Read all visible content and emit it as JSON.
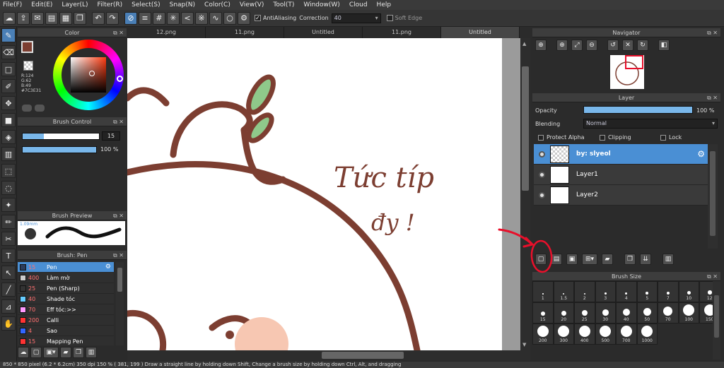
{
  "menu": [
    "File(F)",
    "Edit(E)",
    "Layer(L)",
    "Filter(R)",
    "Select(S)",
    "Snap(N)",
    "Color(C)",
    "View(V)",
    "Tool(T)",
    "Window(W)",
    "Cloud",
    "Help"
  ],
  "toolbar": {
    "antialiasing_label": "AntiAliasing",
    "correction_label": "Correction",
    "correction_value": "40",
    "soft_edge_label": "Soft Edge"
  },
  "tabs": [
    "12.png",
    "11.png",
    "Untitled",
    "11.png",
    "Untitled"
  ],
  "color_panel": {
    "title": "Color",
    "r": "R:124",
    "g": "G:62",
    "b": "B:49",
    "hex": "#7C3E31"
  },
  "brush_control": {
    "title": "Brush Control",
    "size": "15",
    "opacity": "100 %"
  },
  "brush_preview": {
    "title": "Brush Preview",
    "size_label": "1.09mm"
  },
  "brush_list": {
    "title": "Brush: Pen",
    "items": [
      {
        "size": "15",
        "name": "Pen",
        "color": "#2c3c5a"
      },
      {
        "size": "400",
        "name": "Làm mờ",
        "color": "#cccccc"
      },
      {
        "size": "25",
        "name": "Pen (Sharp)",
        "color": "#333333"
      },
      {
        "size": "40",
        "name": "Shade tóc",
        "color": "#66ccff"
      },
      {
        "size": "70",
        "name": "Eff tóc:>>",
        "color": "#ff99ff"
      },
      {
        "size": "200",
        "name": "Calli",
        "color": "#ff3333"
      },
      {
        "size": "4",
        "name": "Sao",
        "color": "#3366ff"
      },
      {
        "size": "15",
        "name": "Mapping Pen",
        "color": "#ff3333"
      }
    ]
  },
  "canvas": {
    "handwriting_line1": "Tức típ",
    "handwriting_line2": "đy !"
  },
  "navigator": {
    "title": "Navigator"
  },
  "layer_panel": {
    "title": "Layer",
    "opacity_label": "Opacity",
    "opacity_value": "100 %",
    "opacity_fraction": 1.0,
    "blending_label": "Blending",
    "blending_value": "Normal",
    "protect_alpha": "Protect Alpha",
    "clipping": "Clipping",
    "lock": "Lock",
    "layers": [
      {
        "name": "by: slyeol",
        "selected": true
      },
      {
        "name": "Layer1",
        "selected": false
      },
      {
        "name": "Layer2",
        "selected": false
      }
    ]
  },
  "brush_size": {
    "title": "Brush Size",
    "sizes": [
      "1",
      "1.5",
      "2",
      "3",
      "4",
      "5",
      "7",
      "10",
      "12",
      "15",
      "20",
      "25",
      "30",
      "40",
      "50",
      "70",
      "100",
      "150",
      "200",
      "300",
      "400",
      "500",
      "700",
      "1000"
    ]
  },
  "status": "850 * 850 pixel  (6.2 * 6.2cm)  350 dpi  150 %  ( 381, 199 )  Draw a straight line by holding down Shift, Change a brush size by holding down Ctrl, Alt, and dragging",
  "colors": {
    "accent": "#4a8fd4",
    "brush_color": "#7C3E31",
    "annotation": "#e8102b"
  }
}
